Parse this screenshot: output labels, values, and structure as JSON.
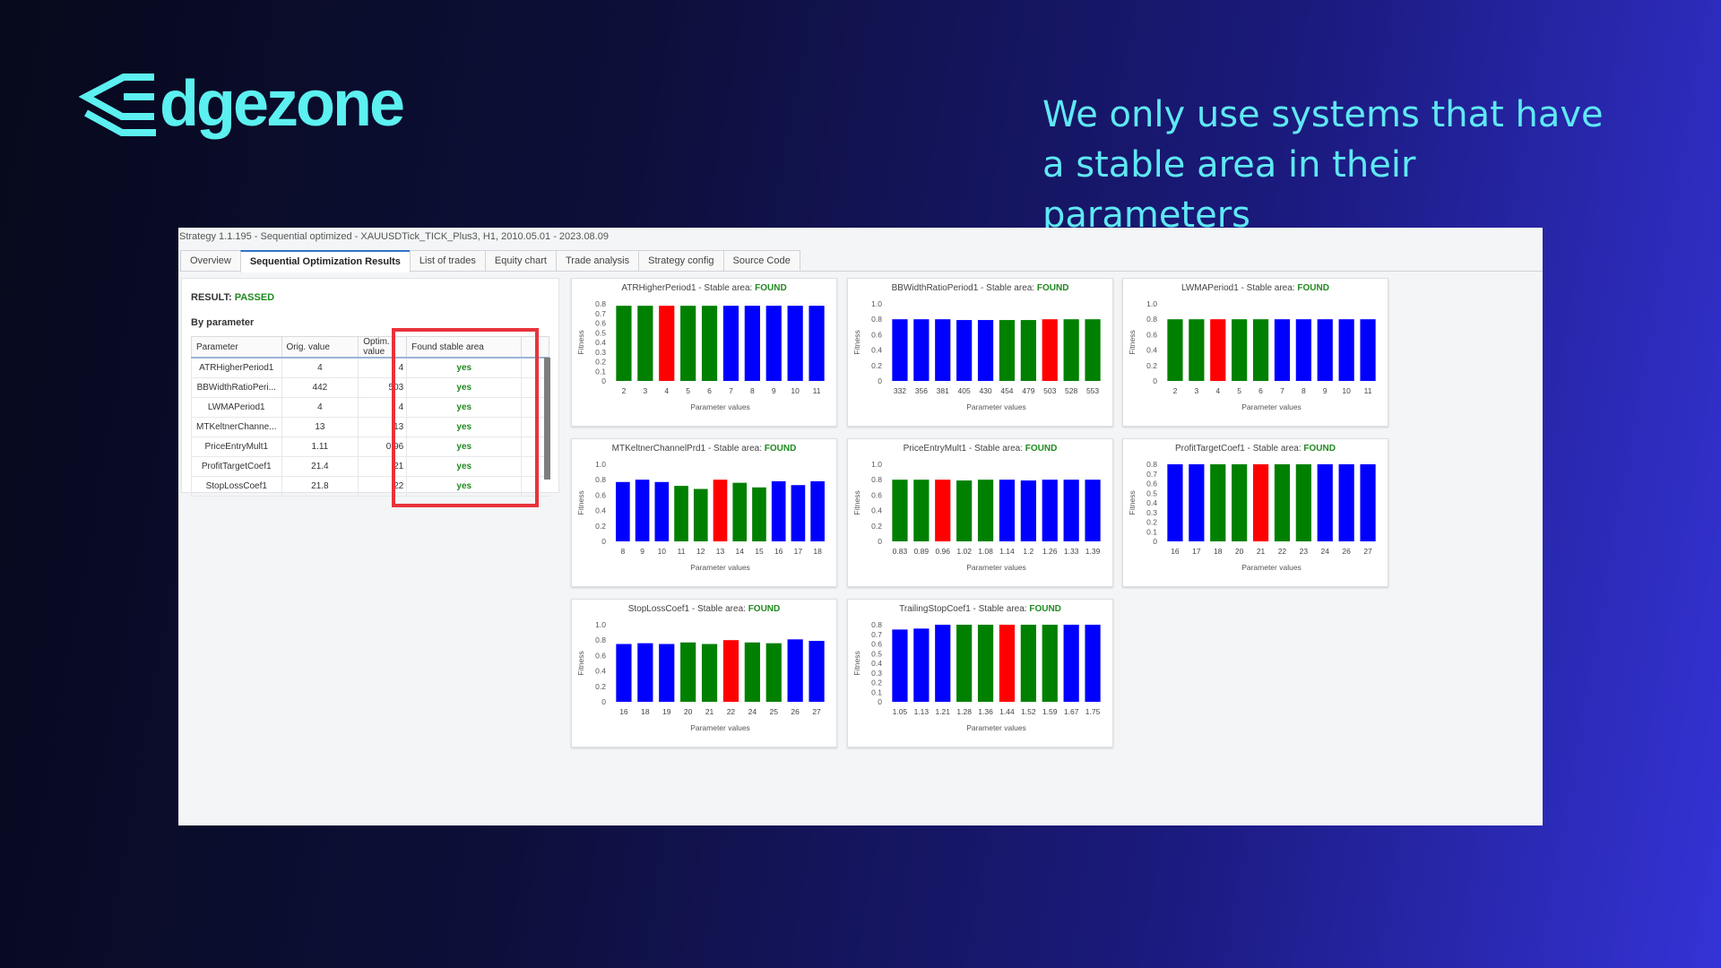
{
  "brand": {
    "logo_text": "dgezone",
    "logo_icon": "stacked-layers-e-icon",
    "color": "#5cf0f0"
  },
  "tagline": "We only use systems that have a stable area in their parameters",
  "window": {
    "title": "Strategy 1.1.195 - Sequential optimized - XAUUSDTick_TICK_Plus3, H1, 2010.05.01 - 2023.08.09",
    "tabs": [
      {
        "label": "Overview",
        "active": false
      },
      {
        "label": "Sequential Optimization Results",
        "active": true
      },
      {
        "label": "List of trades",
        "active": false
      },
      {
        "label": "Equity chart",
        "active": false
      },
      {
        "label": "Trade analysis",
        "active": false
      },
      {
        "label": "Strategy config",
        "active": false
      },
      {
        "label": "Source Code",
        "active": false
      }
    ]
  },
  "results": {
    "result_label": "RESULT:",
    "result_value": "PASSED",
    "by_parameter": "By parameter",
    "columns": [
      "Parameter",
      "Orig. value",
      "Optim. value",
      "Found stable area"
    ],
    "rows": [
      {
        "parameter": "ATRHigherPeriod1",
        "orig": "4",
        "optim": "4",
        "stable": "yes"
      },
      {
        "parameter": "BBWidthRatioPeri...",
        "orig": "442",
        "optim": "503",
        "stable": "yes"
      },
      {
        "parameter": "LWMAPeriod1",
        "orig": "4",
        "optim": "4",
        "stable": "yes"
      },
      {
        "parameter": "MTKeltnerChanne...",
        "orig": "13",
        "optim": "13",
        "stable": "yes"
      },
      {
        "parameter": "PriceEntryMult1",
        "orig": "1.11",
        "optim": "0.96",
        "stable": "yes"
      },
      {
        "parameter": "ProfitTargetCoef1",
        "orig": "21.4",
        "optim": "21",
        "stable": "yes"
      },
      {
        "parameter": "StopLossCoef1",
        "orig": "21.8",
        "optim": "22",
        "stable": "yes"
      }
    ]
  },
  "colors": {
    "blue": "#0000ff",
    "green": "#008000",
    "red": "#ff0000",
    "passed": "#1f8a1f",
    "highlight": "#e8333a"
  },
  "chart_data": [
    {
      "type": "bar",
      "title": "ATRHigherPeriod1 - Stable area:",
      "status": "FOUND",
      "xlabel": "Parameter values",
      "ylabel": "Fitness",
      "ylim": [
        0,
        0.8
      ],
      "yticks": [
        "0",
        "0.1",
        "0.2",
        "0.3",
        "0.4",
        "0.5",
        "0.6",
        "0.7",
        "0.8"
      ],
      "categories": [
        "2",
        "3",
        "4",
        "5",
        "6",
        "7",
        "8",
        "9",
        "10",
        "11"
      ],
      "values": [
        0.78,
        0.78,
        0.78,
        0.78,
        0.78,
        0.78,
        0.78,
        0.78,
        0.78,
        0.78
      ],
      "colors": [
        "green",
        "green",
        "red",
        "green",
        "green",
        "blue",
        "blue",
        "blue",
        "blue",
        "blue"
      ]
    },
    {
      "type": "bar",
      "title": "BBWidthRatioPeriod1 - Stable area:",
      "status": "FOUND",
      "xlabel": "Parameter values",
      "ylabel": "Fitness",
      "ylim": [
        0,
        1.0
      ],
      "yticks": [
        "0",
        "0.2",
        "0.4",
        "0.6",
        "0.8",
        "1.0"
      ],
      "categories": [
        "332",
        "356",
        "381",
        "405",
        "430",
        "454",
        "479",
        "503",
        "528",
        "553"
      ],
      "values": [
        0.8,
        0.8,
        0.8,
        0.79,
        0.79,
        0.79,
        0.79,
        0.8,
        0.8,
        0.8
      ],
      "colors": [
        "blue",
        "blue",
        "blue",
        "blue",
        "blue",
        "green",
        "green",
        "red",
        "green",
        "green"
      ]
    },
    {
      "type": "bar",
      "title": "LWMAPeriod1 - Stable area:",
      "status": "FOUND",
      "xlabel": "Parameter values",
      "ylabel": "Fitness",
      "ylim": [
        0,
        1.0
      ],
      "yticks": [
        "0",
        "0.2",
        "0.4",
        "0.6",
        "0.8",
        "1.0"
      ],
      "categories": [
        "2",
        "3",
        "4",
        "5",
        "6",
        "7",
        "8",
        "9",
        "10",
        "11"
      ],
      "values": [
        0.8,
        0.8,
        0.8,
        0.8,
        0.8,
        0.8,
        0.8,
        0.8,
        0.8,
        0.8
      ],
      "colors": [
        "green",
        "green",
        "red",
        "green",
        "green",
        "blue",
        "blue",
        "blue",
        "blue",
        "blue"
      ]
    },
    {
      "type": "bar",
      "title": "MTKeltnerChannelPrd1 - Stable area:",
      "status": "FOUND",
      "xlabel": "Parameter values",
      "ylabel": "Fitness",
      "ylim": [
        0,
        1.0
      ],
      "yticks": [
        "0",
        "0.2",
        "0.4",
        "0.6",
        "0.8",
        "1.0"
      ],
      "categories": [
        "8",
        "9",
        "10",
        "11",
        "12",
        "13",
        "14",
        "15",
        "16",
        "17",
        "18"
      ],
      "values": [
        0.77,
        0.8,
        0.77,
        0.72,
        0.68,
        0.8,
        0.76,
        0.7,
        0.78,
        0.73,
        0.78
      ],
      "colors": [
        "blue",
        "blue",
        "blue",
        "green",
        "green",
        "red",
        "green",
        "green",
        "blue",
        "blue",
        "blue"
      ]
    },
    {
      "type": "bar",
      "title": "PriceEntryMult1 - Stable area:",
      "status": "FOUND",
      "xlabel": "Parameter values",
      "ylabel": "Fitness",
      "ylim": [
        0,
        1.0
      ],
      "yticks": [
        "0",
        "0.2",
        "0.4",
        "0.6",
        "0.8",
        "1.0"
      ],
      "categories": [
        "0.83",
        "0.89",
        "0.96",
        "1.02",
        "1.08",
        "1.14",
        "1.2",
        "1.26",
        "1.33",
        "1.39"
      ],
      "values": [
        0.8,
        0.8,
        0.8,
        0.79,
        0.8,
        0.8,
        0.79,
        0.8,
        0.8,
        0.8
      ],
      "colors": [
        "green",
        "green",
        "red",
        "green",
        "green",
        "blue",
        "blue",
        "blue",
        "blue",
        "blue"
      ]
    },
    {
      "type": "bar",
      "title": "ProfitTargetCoef1 - Stable area:",
      "status": "FOUND",
      "xlabel": "Parameter values",
      "ylabel": "Fitness",
      "ylim": [
        0,
        0.8
      ],
      "yticks": [
        "0",
        "0.1",
        "0.2",
        "0.3",
        "0.4",
        "0.5",
        "0.6",
        "0.7",
        "0.8"
      ],
      "categories": [
        "16",
        "17",
        "18",
        "20",
        "21",
        "22",
        "23",
        "24",
        "26",
        "27"
      ],
      "values": [
        0.8,
        0.8,
        0.8,
        0.8,
        0.8,
        0.8,
        0.8,
        0.8,
        0.8,
        0.8
      ],
      "colors": [
        "blue",
        "blue",
        "green",
        "green",
        "red",
        "green",
        "green",
        "blue",
        "blue",
        "blue"
      ]
    },
    {
      "type": "bar",
      "title": "StopLossCoef1 - Stable area:",
      "status": "FOUND",
      "xlabel": "Parameter values",
      "ylabel": "Fitness",
      "ylim": [
        0,
        1.0
      ],
      "yticks": [
        "0",
        "0.2",
        "0.4",
        "0.6",
        "0.8",
        "1.0"
      ],
      "categories": [
        "16",
        "18",
        "19",
        "20",
        "21",
        "22",
        "24",
        "25",
        "26",
        "27"
      ],
      "values": [
        0.75,
        0.76,
        0.75,
        0.77,
        0.75,
        0.8,
        0.77,
        0.76,
        0.81,
        0.79
      ],
      "colors": [
        "blue",
        "blue",
        "blue",
        "green",
        "green",
        "red",
        "green",
        "green",
        "blue",
        "blue"
      ]
    },
    {
      "type": "bar",
      "title": "TrailingStopCoef1 - Stable area:",
      "status": "FOUND",
      "xlabel": "Parameter values",
      "ylabel": "Fitness",
      "ylim": [
        0,
        0.8
      ],
      "yticks": [
        "0",
        "0.1",
        "0.2",
        "0.3",
        "0.4",
        "0.5",
        "0.6",
        "0.7",
        "0.8"
      ],
      "categories": [
        "1.05",
        "1.13",
        "1.21",
        "1.28",
        "1.36",
        "1.44",
        "1.52",
        "1.59",
        "1.67",
        "1.75"
      ],
      "values": [
        0.75,
        0.76,
        0.8,
        0.8,
        0.8,
        0.8,
        0.8,
        0.8,
        0.8,
        0.8
      ],
      "colors": [
        "blue",
        "blue",
        "blue",
        "green",
        "green",
        "red",
        "green",
        "green",
        "blue",
        "blue"
      ]
    }
  ]
}
